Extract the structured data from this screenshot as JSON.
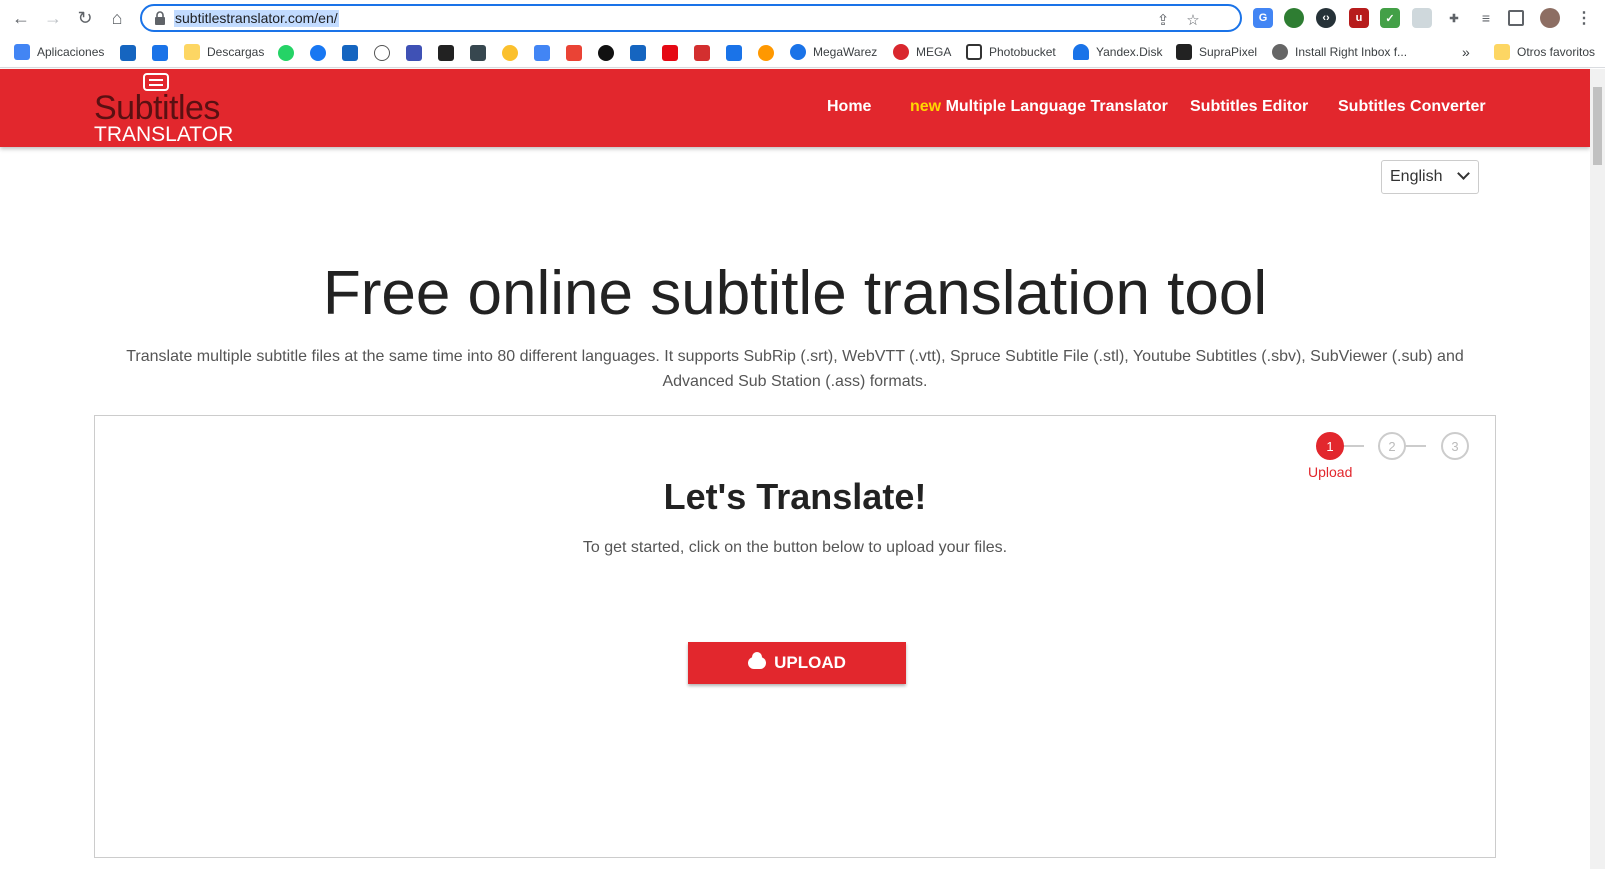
{
  "browser": {
    "url": "subtitlestranslator.com/en/",
    "bookmarks": [
      {
        "label": "Aplicaciones",
        "color": "#4285f4"
      },
      {
        "label": "Descargas",
        "color": "#fdd663"
      },
      {
        "label": "MegaWarez",
        "color": "#1a73e8"
      },
      {
        "label": "MEGA",
        "color": "#d9272e"
      },
      {
        "label": "Photobucket",
        "color": "#333333"
      },
      {
        "label": "Yandex.Disk",
        "color": "#1a73e8"
      },
      {
        "label": "SupraPixel",
        "color": "#222222"
      },
      {
        "label": "Install Right Inbox f...",
        "color": "#666666"
      }
    ],
    "more_bookmarks": "»",
    "other_favorites": "Otros favoritos"
  },
  "site": {
    "logo_line1": "Subtitles",
    "logo_line2": "TRANSLATOR",
    "menu": {
      "home": "Home",
      "new_badge": "new",
      "multi": "Multiple Language Translator",
      "editor": "Subtitles Editor",
      "converter": "Subtitles Converter"
    },
    "language": "English"
  },
  "hero": {
    "title": "Free online subtitle translation tool",
    "subtitle": "Translate multiple subtitle files at the same time into 80 different languages. It supports SubRip (.srt), WebVTT (.vtt), Spruce Subtitle File (.stl), Youtube Subtitles (.sbv), SubViewer (.sub) and Advanced Sub Station (.ass) formats."
  },
  "wizard": {
    "steps": [
      "1",
      "2",
      "3"
    ],
    "active_label": "Upload",
    "title": "Let's Translate!",
    "description": "To get started, click on the button below to upload your files.",
    "upload_label": "UPLOAD"
  }
}
